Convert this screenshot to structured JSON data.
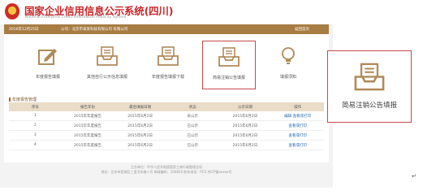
{
  "header": {
    "title": "国家企业信用信息公示系统(四川)",
    "subtitle": "National Enterprise Credit Information Publicity System"
  },
  "topbar": {
    "date": "2016年12月25日",
    "company": "公司：北京市某某科技有限公司 有限公司",
    "logout": "返回首页"
  },
  "tiles": [
    {
      "label": "年度报告填报",
      "icon": "pencil-edit-icon"
    },
    {
      "label": "其他自行公示信息填报",
      "icon": "tray-document-icon"
    },
    {
      "label": "年度报告填报下载",
      "icon": "tray-document-icon"
    },
    {
      "label": "简易注销公告填报",
      "icon": "tray-document-icon",
      "selected": true
    },
    {
      "label": "填报须知",
      "icon": "lightbulb-icon"
    }
  ],
  "section_title": "年度报告管理",
  "table": {
    "headers": [
      "序号",
      "报告年份",
      "最后填报日期",
      "状态",
      "公示日期",
      "操作"
    ],
    "rows": [
      {
        "num": "1",
        "year": "2015年年度报告",
        "date": "2015年6月2日",
        "status": "未公示",
        "pub": "2015年6月2日",
        "action": "编辑  查看或打印"
      },
      {
        "num": "2",
        "year": "2015年年度报告",
        "date": "2015年6月2日",
        "status": "已公示",
        "pub": "2015年6月2日",
        "action": "查看或打印"
      },
      {
        "num": "3",
        "year": "2015年年度报告",
        "date": "2015年6月2日",
        "status": "已公示",
        "pub": "2015年6月2日",
        "action": "查看或打印"
      },
      {
        "num": "4",
        "year": "2015年年度报告",
        "date": "2015年6月2日",
        "status": "已公示",
        "pub": "2015年6月2日",
        "action": "查看或打印"
      }
    ]
  },
  "footer": {
    "line1": "主办单位：中华人民共和国国家工商行政管理总局",
    "line2": "地址：北京市西城区三里河东路八号  邮政编码：100820  联系电话：PCS 京ICP备xxxxx号"
  },
  "zoom": {
    "label": "简易注销公告填报",
    "icon": "tray-document-icon"
  },
  "mark": "↵",
  "colors": {
    "brand_red": "#c9282c",
    "bar_brown": "#a77d44",
    "icon_brown": "#b08a58",
    "highlight_red": "#c8484c"
  }
}
